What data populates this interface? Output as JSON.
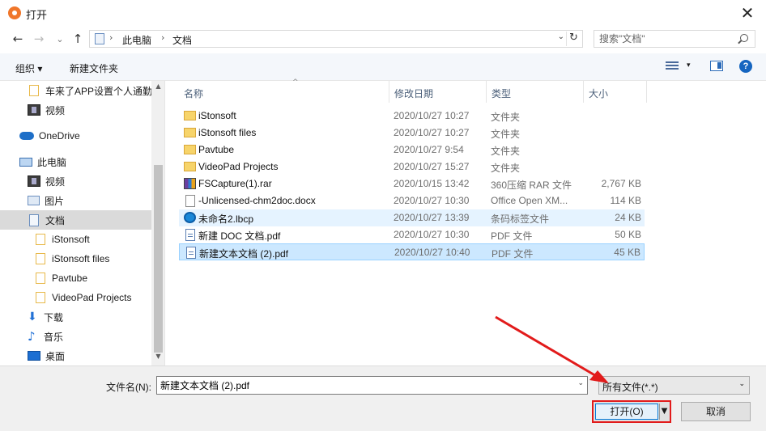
{
  "window": {
    "title": "打开",
    "close_glyph": "✕"
  },
  "nav_buttons": {
    "back": "←",
    "forward": "→",
    "recent": "⌄",
    "up": "↑"
  },
  "address": {
    "crumbs": [
      "此电脑",
      "文档"
    ],
    "separator": "›",
    "dropdown": "⌄",
    "refresh": "↻"
  },
  "search": {
    "placeholder": "搜索\"文档\""
  },
  "toolbar": {
    "organize": "组织 ▾",
    "new_folder": "新建文件夹",
    "view_dd": "▾",
    "help": "?"
  },
  "sidebar": {
    "items": [
      {
        "label": "车来了APP设置个人通勤",
        "icon": "folder"
      },
      {
        "label": "视频",
        "icon": "video"
      },
      {
        "label": "OneDrive",
        "icon": "cloud"
      },
      {
        "label": "此电脑",
        "icon": "pc"
      },
      {
        "label": "视频",
        "icon": "video"
      },
      {
        "label": "图片",
        "icon": "picture"
      },
      {
        "label": "文档",
        "icon": "doc",
        "selected": true
      },
      {
        "label": "iStonsoft",
        "icon": "folder"
      },
      {
        "label": "iStonsoft files",
        "icon": "folder"
      },
      {
        "label": "Pavtube",
        "icon": "folder"
      },
      {
        "label": "VideoPad Projects",
        "icon": "folder"
      },
      {
        "label": "下载",
        "icon": "download"
      },
      {
        "label": "音乐",
        "icon": "music"
      },
      {
        "label": "桌面",
        "icon": "desktop"
      }
    ],
    "scroll_up": "▲",
    "scroll_down": "▼"
  },
  "columns": {
    "name": "名称",
    "date": "修改日期",
    "type": "类型",
    "size": "大小",
    "sort_glyph": "^"
  },
  "files": [
    {
      "name": "iStonsoft",
      "date": "2020/10/27 10:27",
      "type": "文件夹",
      "size": "",
      "icon": "folder"
    },
    {
      "name": "iStonsoft files",
      "date": "2020/10/27 10:27",
      "type": "文件夹",
      "size": "",
      "icon": "folder"
    },
    {
      "name": "Pavtube",
      "date": "2020/10/27 9:54",
      "type": "文件夹",
      "size": "",
      "icon": "folder"
    },
    {
      "name": "VideoPad Projects",
      "date": "2020/10/27 15:27",
      "type": "文件夹",
      "size": "",
      "icon": "folder"
    },
    {
      "name": "FSCapture(1).rar",
      "date": "2020/10/15 13:42",
      "type": "360压缩 RAR 文件",
      "size": "2,767 KB",
      "icon": "rar"
    },
    {
      "name": "-Unlicensed-chm2doc.docx",
      "date": "2020/10/27 10:30",
      "type": "Office Open XM...",
      "size": "114 KB",
      "icon": "docx"
    },
    {
      "name": "未命名2.lbcp",
      "date": "2020/10/27 13:39",
      "type": "条码标签文件",
      "size": "24 KB",
      "icon": "lbcp",
      "state": "hover"
    },
    {
      "name": "新建 DOC 文档.pdf",
      "date": "2020/10/27 10:30",
      "type": "PDF 文件",
      "size": "50 KB",
      "icon": "pdf"
    },
    {
      "name": "新建文本文档 (2).pdf",
      "date": "2020/10/27 10:40",
      "type": "PDF 文件",
      "size": "45 KB",
      "icon": "pdf",
      "state": "selected"
    }
  ],
  "bottom": {
    "filename_label": "文件名(N):",
    "filename_value": "新建文本文档 (2).pdf",
    "filename_dd": "⌄",
    "filter": "所有文件(*.*)",
    "filter_dd": "⌄",
    "open": "打开(O)",
    "open_split": "▼",
    "cancel": "取消"
  },
  "colors": {
    "annotation": "#e21b1b",
    "selected_row": "#cce8ff",
    "hover_row": "#e5f3ff",
    "help": "#1565c0"
  }
}
